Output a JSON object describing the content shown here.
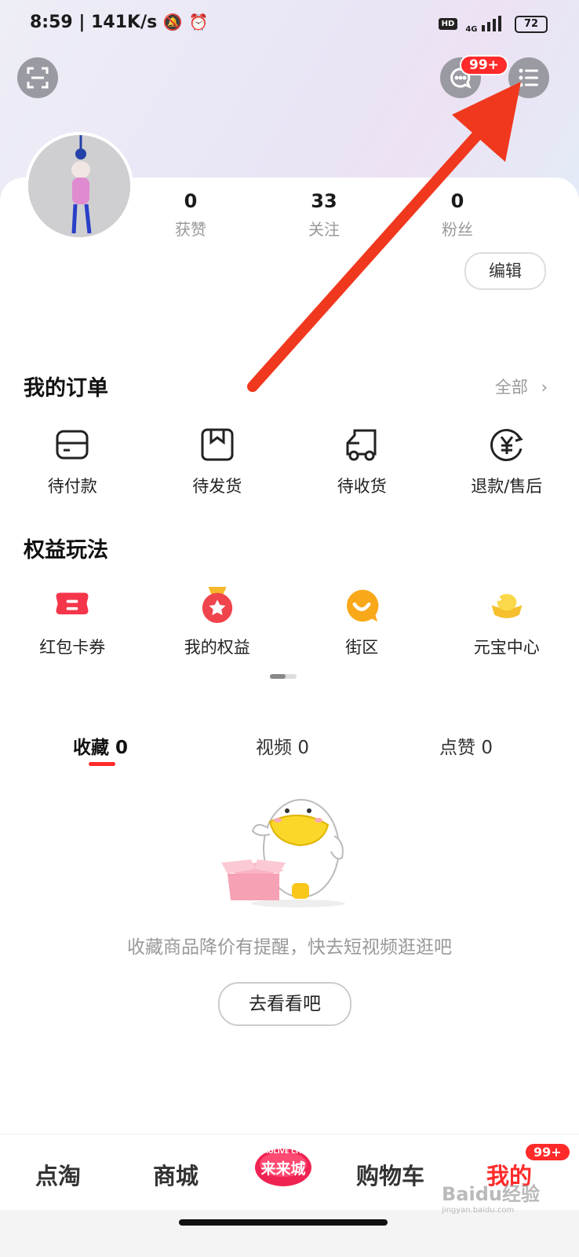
{
  "status_bar": {
    "time": "8:59",
    "speed": "141K/s",
    "network": "4G",
    "hd": "HD",
    "battery": "72"
  },
  "header": {
    "message_badge": "99+"
  },
  "profile": {
    "stats": [
      {
        "value": "0",
        "label": "获赞"
      },
      {
        "value": "33",
        "label": "关注"
      },
      {
        "value": "0",
        "label": "粉丝"
      }
    ],
    "edit_label": "编辑"
  },
  "orders": {
    "title": "我的订单",
    "all_label": "全部",
    "items": [
      {
        "label": "待付款",
        "icon": "wallet-icon"
      },
      {
        "label": "待发货",
        "icon": "box-icon"
      },
      {
        "label": "待收货",
        "icon": "truck-icon"
      },
      {
        "label": "退款/售后",
        "icon": "refund-icon"
      }
    ]
  },
  "benefits": {
    "title": "权益玩法",
    "items": [
      {
        "label": "红包卡券",
        "icon": "coupon-icon"
      },
      {
        "label": "我的权益",
        "icon": "medal-icon"
      },
      {
        "label": "街区",
        "icon": "smile-icon"
      },
      {
        "label": "元宝中心",
        "icon": "ingot-icon"
      }
    ]
  },
  "content_tabs": [
    {
      "label": "收藏",
      "count": "0"
    },
    {
      "label": "视频",
      "count": "0"
    },
    {
      "label": "点赞",
      "count": "0"
    }
  ],
  "empty_state": {
    "message": "收藏商品降价有提醒，快去短视频逛逛吧",
    "button": "去看看吧"
  },
  "bottom_nav": {
    "items": [
      "点淘",
      "商城",
      "购物车",
      "我的"
    ],
    "center_logo_top": "TAOLIVE CITY",
    "center_logo": "来来城",
    "mine_badge": "99+"
  },
  "watermark": "Baidu经验",
  "watermark_url": "jingyan.baidu.com",
  "colors": {
    "accent": "#ff2a2a",
    "arrow": "#f0381e"
  }
}
